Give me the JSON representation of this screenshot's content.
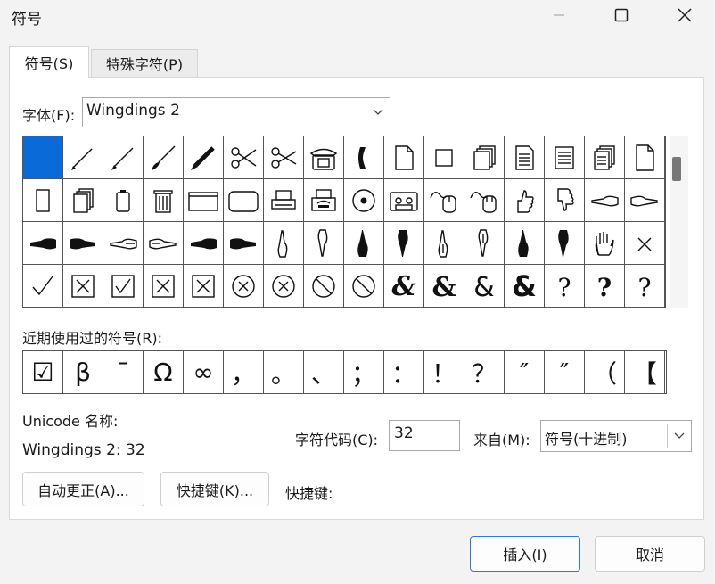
{
  "window": {
    "title": "符号"
  },
  "tabs": [
    {
      "label": "符号(S)"
    },
    {
      "label": "特殊字符(P)"
    }
  ],
  "font": {
    "label": "字体(F):",
    "value": "Wingdings 2"
  },
  "symbol_grid": {
    "rows": [
      [
        "",
        "pencil-icon",
        "pen-icon",
        "brush-icon",
        "marker-icon",
        "open-scissors-icon",
        "scissors-icon",
        "telephone-icon",
        "handset-icon",
        "folded-page-icon",
        "blank-square-icon",
        "stacked-pages-icon",
        "lined-page-icon",
        "list-page-icon",
        "multi-page-icon",
        "blank-page-icon"
      ],
      [
        "tall-rectangle-icon",
        "stacked-cards-icon",
        "battery-icon",
        "trash-can-icon",
        "window-frame-icon",
        "rounded-rectangle-icon",
        "printer-icon",
        "fax-icon",
        "disc-icon",
        "cassette-icon",
        "mouse-icon",
        "mouse-alt-icon",
        "thumbs-up-outline-icon",
        "thumbs-down-outline-icon",
        "point-left-outline-icon",
        "point-right-outline-icon"
      ],
      [
        "point-left-black-icon",
        "point-right-black-icon",
        "point-left-white-icon",
        "point-right-white-icon",
        "point-left-dark-icon",
        "point-right-dark-icon",
        "point-up-outline-icon",
        "point-down-outline-icon",
        "point-up-black-icon",
        "point-down-black-icon",
        "point-up-white-icon",
        "point-down-white-icon",
        "point-up-dark-icon",
        "point-down-dark-icon",
        "open-hand-icon",
        "x-mark-icon"
      ],
      [
        "check-mark-icon",
        "boxed-x-icon",
        "boxed-check-icon",
        "boxed-x-thin-icon",
        "boxed-x-bold-icon",
        "circled-x-icon",
        "circled-x-bold-icon",
        "prohibited-icon",
        "prohibited-bold-icon",
        "et-ampersand-icon",
        "ampersand-bold-icon",
        "ampersand-outline-icon",
        "ampersand-heavy-icon",
        "interrobang-icon",
        "interrobang-bold-icon",
        "interrobang-alt-icon"
      ]
    ]
  },
  "recent": {
    "label": "近期使用过的符号(R):",
    "items": [
      "☑",
      "β",
      "¯",
      "Ω",
      "∞",
      "，",
      "。",
      "、",
      "；",
      "：",
      "！",
      "？",
      "″",
      "″",
      "（",
      "【"
    ]
  },
  "unicode_name": {
    "label": "Unicode 名称:",
    "value": "Wingdings 2: 32"
  },
  "char_code": {
    "label": "字符代码(C):",
    "value": "32"
  },
  "from": {
    "label": "来自(M):",
    "value": "符号(十进制)"
  },
  "buttons": {
    "autocorrect": "自动更正(A)...",
    "shortcut_key": "快捷键(K)...",
    "shortcut_label": "快捷键:",
    "insert": "插入(I)",
    "cancel": "取消"
  },
  "colors": {
    "selection": "#0a6bd8",
    "primary_border": "#2b7bd6"
  }
}
